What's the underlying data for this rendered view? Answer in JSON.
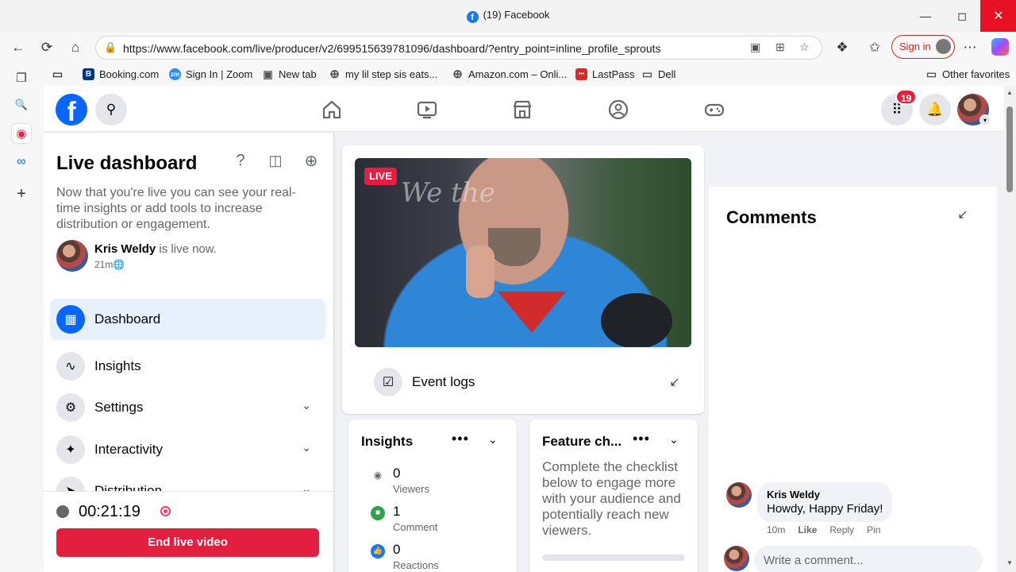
{
  "browser": {
    "window_title": "(19) Facebook",
    "url": "https://www.facebook.com/live/producer/v2/699515639781096/dashboard/?entry_point=inline_profile_sprouts",
    "sign_in": "Sign in",
    "bookmarks": [
      {
        "label": "Booking.com",
        "icon": "B",
        "color": "#003580"
      },
      {
        "label": "Sign In | Zoom",
        "icon": "zm",
        "color": "#2d8cff"
      },
      {
        "label": "New tab",
        "icon": "▣",
        "color": "#555555"
      },
      {
        "label": "my lil step sis eats...",
        "icon": "⊕",
        "color": "#555555"
      },
      {
        "label": "Amazon.com – Onli...",
        "icon": "⊕",
        "color": "#555555"
      },
      {
        "label": "LastPass",
        "icon": "•••",
        "color": "#d32d27"
      },
      {
        "label": "Dell",
        "icon": "▭",
        "color": "#555555"
      }
    ],
    "other_favorites": "Other favorites"
  },
  "fb": {
    "notifications_count": "19"
  },
  "left": {
    "title": "Live dashboard",
    "description": "Now that you're live you can see your real-time insights or add tools to increase distribution or engagement.",
    "user_name": "Kris Weldy",
    "user_status": " is live now.",
    "elapsed": "21m",
    "menu": [
      {
        "label": "Dashboard",
        "icon": "dashboard-icon"
      },
      {
        "label": "Insights",
        "icon": "insights-icon"
      },
      {
        "label": "Settings",
        "icon": "gear-icon"
      },
      {
        "label": "Interactivity",
        "icon": "sparkle-icon"
      },
      {
        "label": "Distribution",
        "icon": "share-icon"
      }
    ],
    "timer": "00:21:19",
    "end_button": "End live video"
  },
  "video": {
    "live_badge": "LIVE",
    "event_logs": "Event logs"
  },
  "insights": {
    "title": "Insights",
    "metrics": [
      {
        "value": "0",
        "label": "Viewers",
        "icon": "eye-icon",
        "color": "#65676b"
      },
      {
        "value": "1",
        "label": "Comment",
        "icon": "comment-icon",
        "color": "#31a24c"
      },
      {
        "value": "0",
        "label": "Reactions",
        "icon": "like-icon",
        "color": "#1877f2"
      }
    ]
  },
  "feature": {
    "title": "Feature ch...",
    "text": "Complete the checklist below to engage more with your audience and potentially reach new viewers."
  },
  "comments": {
    "title": "Comments",
    "items": [
      {
        "name": "Kris Weldy",
        "text": "Howdy, Happy Friday!",
        "time": "10m",
        "like": "Like",
        "reply": "Reply",
        "pin": "Pin"
      }
    ],
    "placeholder": "Write a comment..."
  }
}
